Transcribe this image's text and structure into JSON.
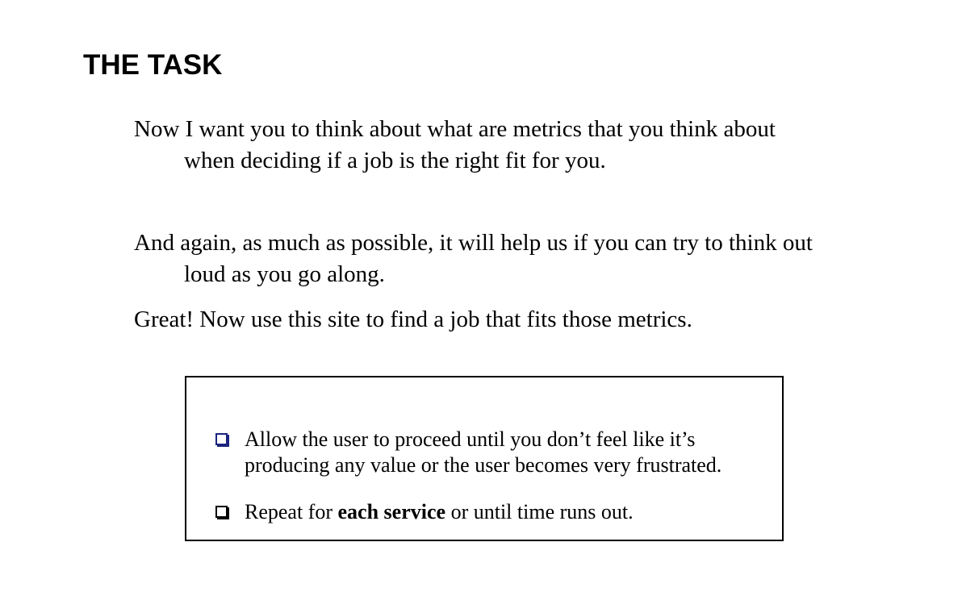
{
  "heading": "THE TASK",
  "paragraphs": [
    "Now I want you to think about what are metrics that you think about when deciding if a job is the right fit for you.",
    "And again, as much as possible, it will help us if you can try to think out loud as you go along.",
    "Great! Now use this site to find a job that fits those metrics."
  ],
  "checklist": {
    "items": [
      {
        "text": "Allow the user to proceed until you don’t feel like it’s producing any value or the user becomes very frustrated."
      },
      {
        "text_before": "Repeat for ",
        "text_bold": "each service",
        "text_after": " or until time runs out."
      }
    ]
  },
  "colors": {
    "text": "#000000",
    "background": "#ffffff",
    "checkbox_highlight": "#1a237e"
  },
  "icons": [
    "checkbox-icon",
    "checkbox-icon"
  ]
}
